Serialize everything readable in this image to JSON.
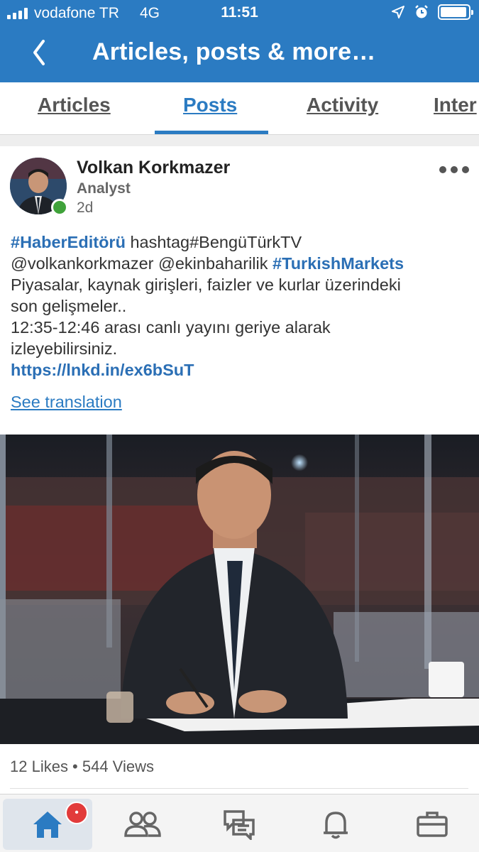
{
  "status_bar": {
    "carrier": "vodafone TR",
    "network": "4G",
    "time": "11:51"
  },
  "header": {
    "title": "Articles, posts & more…"
  },
  "tabs": [
    {
      "label": "Articles",
      "active": false
    },
    {
      "label": "Posts",
      "active": true
    },
    {
      "label": "Activity",
      "active": false
    },
    {
      "label": "Inter",
      "active": false
    }
  ],
  "post": {
    "author_name": "Volkan Korkmazer",
    "author_role": "Analyst",
    "time_ago": "2d",
    "text": {
      "hashtag1": "#HaberEditörü",
      "line1_rest": " hashtag#BengüTürkTV",
      "mentions": "@volkankorkmazer @ekinbaharilik ",
      "hashtag2": "#TurkishMarkets",
      "line3": "Piyasalar, kaynak girişleri, faizler ve kurlar üzerindeki",
      "line4": "son gelişmeler..",
      "line5": "12:35-12:46 arası canlı yayını geriye alarak",
      "line6": "izleyebilirsiniz.",
      "link": "https://lnkd.in/ex6bSuT"
    },
    "see_translation": "See translation",
    "stats": "12 Likes • 544 Views"
  },
  "bottom_nav": [
    {
      "name": "home",
      "icon": "home-icon",
      "active": true,
      "badge": "•"
    },
    {
      "name": "network",
      "icon": "people-icon",
      "active": false
    },
    {
      "name": "messaging",
      "icon": "messages-icon",
      "active": false
    },
    {
      "name": "notifications",
      "icon": "bell-icon",
      "active": false
    },
    {
      "name": "jobs",
      "icon": "briefcase-icon",
      "active": false
    }
  ],
  "colors": {
    "brand_blue": "#2b7bc2",
    "link_blue": "#2b6fb5",
    "online_green": "#3fa23a",
    "badge_red": "#e23b3b"
  }
}
